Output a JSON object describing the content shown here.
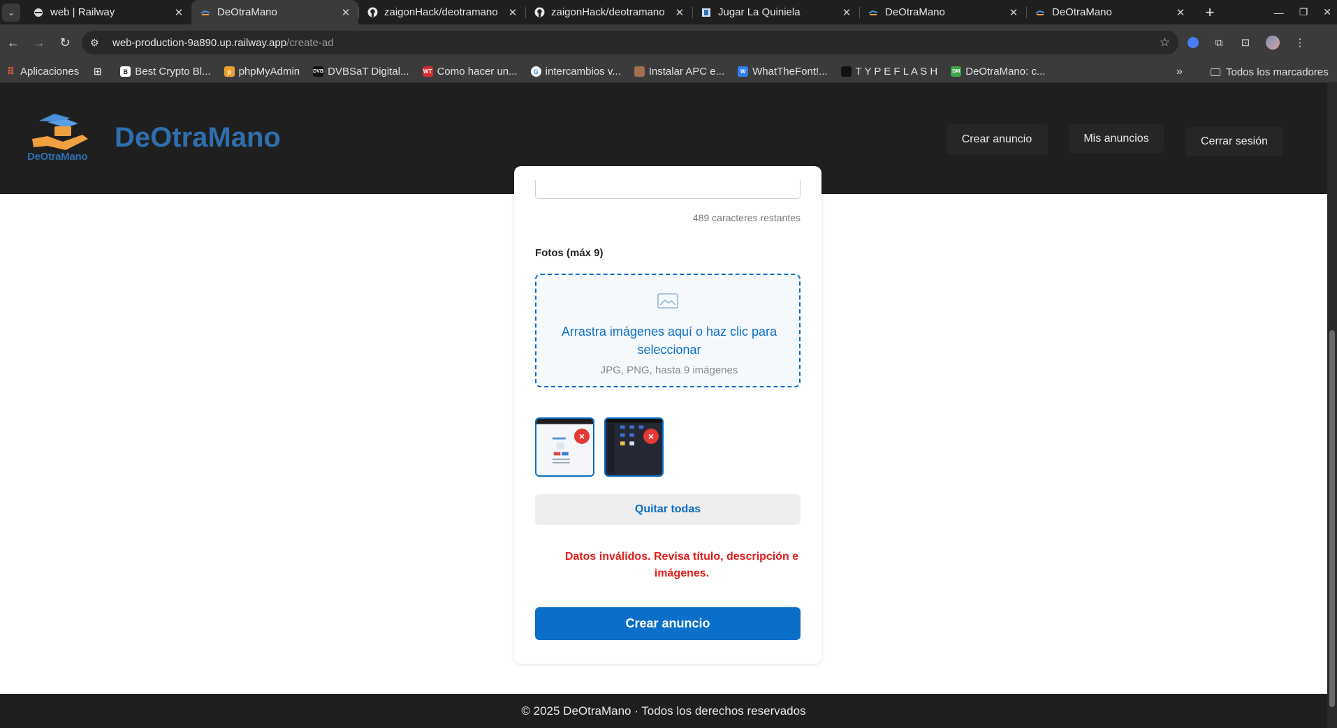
{
  "browser": {
    "tabs": [
      {
        "title": "web | Railway",
        "icon": "railway-icon",
        "active": false
      },
      {
        "title": "DeOtraMano",
        "icon": "deotramano-favicon",
        "active": true
      },
      {
        "title": "zaigonHack/deotramano",
        "icon": "github-icon",
        "active": false
      },
      {
        "title": "zaigonHack/deotramano",
        "icon": "github-icon",
        "active": false
      },
      {
        "title": "Jugar La Quiniela",
        "icon": "quiniela-favicon",
        "active": false
      },
      {
        "title": "DeOtraMano",
        "icon": "deotramano-favicon",
        "active": false
      },
      {
        "title": "DeOtraMano",
        "icon": "deotramano-favicon",
        "active": false
      }
    ],
    "url_host": "web-production-9a890.up.railway.app",
    "url_path": "/create-ad",
    "bookmarks": [
      {
        "label": "Aplicaciones",
        "icon": "apps-grid-icon"
      },
      {
        "label": "Best Crypto Bl...",
        "icon": "crypto-favicon"
      },
      {
        "label": "phpMyAdmin",
        "icon": "phpmyadmin-favicon"
      },
      {
        "label": "DVBSaT Digital...",
        "icon": "dvb-favicon"
      },
      {
        "label": "Como hacer un...",
        "icon": "wt-favicon"
      },
      {
        "label": "intercambios v...",
        "icon": "google-favicon"
      },
      {
        "label": "Instalar APC e...",
        "icon": "person-favicon"
      },
      {
        "label": "WhatTheFont!...",
        "icon": "whatthefont-favicon"
      },
      {
        "label": "T Y P E F L A S H",
        "icon": "typeflash-favicon"
      },
      {
        "label": "DeOtraMano: c...",
        "icon": "dm-favicon"
      }
    ],
    "all_bookmarks": "Todos los marcadores"
  },
  "header": {
    "logo_text": "DeOtraMano",
    "brand": "DeOtraMano",
    "nav": {
      "create": "Crear anuncio",
      "my_ads": "Mis anuncios",
      "logout": "Cerrar sesión"
    }
  },
  "form": {
    "chars_remaining": "489 caracteres restantes",
    "photos_label": "Fotos (máx 9)",
    "dropzone_text": "Arrastra imágenes aquí o haz clic para seleccionar",
    "dropzone_hint": "JPG, PNG, hasta 9 imágenes",
    "thumbnails": [
      {
        "remove_label": "×",
        "theme": "light"
      },
      {
        "remove_label": "×",
        "theme": "dark"
      }
    ],
    "remove_all": "Quitar todas",
    "error": "Datos inválidos. Revisa título, descripción e imágenes.",
    "submit": "Crear anuncio"
  },
  "footer": {
    "text": "© 2025 DeOtraMano · Todos los derechos reservados"
  },
  "colors": {
    "brand_blue": "#2f6fb0",
    "primary": "#0a6fc9",
    "error": "#e21c1c",
    "remove": "#e53935"
  }
}
